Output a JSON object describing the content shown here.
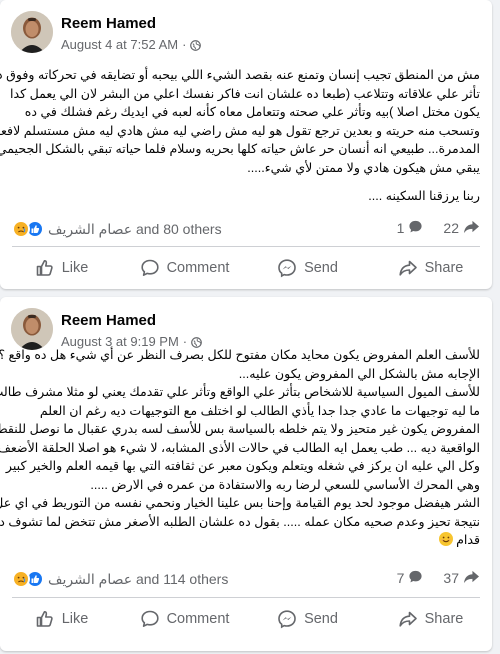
{
  "posts": [
    {
      "author": "Reem Hamed",
      "date": "August 4 at 7:52 AM",
      "separator": "·",
      "lines": [
        "مش من المنطق تجيب إنسان وتمنع عنه بقصد الشيء اللي بيحبه أو تضايقه في تحركاته وفوق ده",
        "تأثر علي علاقاته وتتلاعب (طبعا ده علشان انت فاكر نفسك اعلي من البشر لان الي يعمل كدا",
        "يكون مختل اصلا )بيه وتأثر علي صحته وتتعامل معاه كأنه لعبه في ايديك رغم فشلك في ده",
        "وتسحب منه حريته و بعدين ترجع تقول هو ليه مش راضي ليه مش هادي ليه مش مستسلم لافعالي",
        "المدمرة... طبيعي انه أنسان حر عاش حياته كلها بحريه وسلام فلما حياته تبقي بالشكل الجحيمي ده",
        "يبقي مش هيكون هادي ولا ممتن لأي شيء.....",
        "",
        "ربنا يرزقنا السكينه ...."
      ],
      "reactions_text": "عصام الشريف and 80 others",
      "comments_count": "1",
      "shares_count": "22",
      "actions": {
        "like": "Like",
        "comment": "Comment",
        "send": "Send",
        "share": "Share"
      }
    },
    {
      "author": "Reem Hamed",
      "date": "August 3 at 9:19 PM",
      "separator": "·",
      "lines": [
        "للأسف العلم المفروض يكون محايد مكان مفتوح للكل بصرف النظر عن أي شيء هل ده واقع ؟!",
        "الإجابه مش بالشكل الي المفروض يكون عليه...",
        "للأسف الميول السياسية للاشخاص بتأثر علي الواقع وتأثر علي تقدمك يعني لو مثلا مشرف طالب",
        "ما ليه توجيهات ما عادي جدا جدا يأذي الطالب لو اختلف مع التوجيهات ديه رغم ان العلم",
        "المفروض يكون غير متحيز ولا يتم خلطه بالسياسة بس للأسف لسه بدري عقبال ما نوصل للنقطة",
        "الواقعية ديه ... طب يعمل ايه الطالب في حالات الأذى المشابه، لا شيء هو اصلا الحلقة الأضعف",
        "وكل الي عليه ان يركز في شغله ويتعلم ويكون معبر عن ثقافته التي بها قيمه العلم والخير كبير",
        "وهي المحرك الأساسي للسعي لرضا ربه والاستفادة من عمره في الارض .....",
        "الشر هيفضل موجود لحد يوم القيامة  وإحنا بس علينا الخيار ونحمي نفسه من التوريط في اي عل",
        "نتيجة تحيز وعدم صحيه مكان عمله ..... بقول ده علشان الطلبه الأصغر مش تتخض لما تشوف ده",
        "قدام"
      ],
      "reactions_text": "عصام الشريف and 114 others",
      "comments_count": "7",
      "shares_count": "37",
      "actions": {
        "like": "Like",
        "comment": "Comment",
        "send": "Send",
        "share": "Share"
      }
    }
  ],
  "icons": {
    "privacy": "globe-icon",
    "reaction_1": "sad-face-icon",
    "reaction_2": "thumbs-up-icon",
    "comment": "comment-bubble-icon",
    "share": "share-arrow-icon",
    "emoji_end": "smiling-face-icon"
  },
  "colors": {
    "background": "#f0f2f5",
    "card": "#ffffff",
    "secondary_text": "#65676b",
    "like_blue": "#1877f2",
    "reaction_yellow": "#f7b125"
  }
}
